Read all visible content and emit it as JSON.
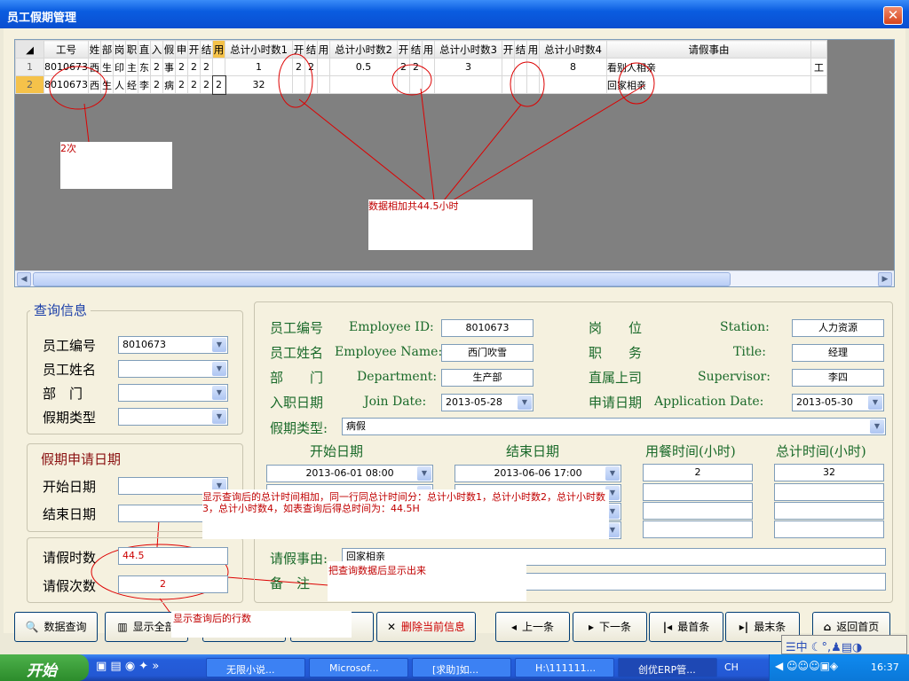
{
  "window": {
    "title": "员工假期管理"
  },
  "grid": {
    "headers": [
      "工号",
      "姓",
      "部",
      "岗",
      "职",
      "直",
      "入",
      "假",
      "申",
      "开",
      "结",
      "用",
      "总计小时数1",
      "开",
      "结",
      "用",
      "总计小时数2",
      "开",
      "结",
      "用",
      "总计小时数3",
      "开",
      "结",
      "用",
      "总计小时数4",
      "请假事由"
    ],
    "rows": [
      {
        "num": "1",
        "cells": [
          "8010673",
          "西",
          "生",
          "印",
          "主",
          "东",
          "2",
          "事",
          "2",
          "2",
          "2",
          "",
          "1",
          "2",
          "2",
          "",
          "0.5",
          "2",
          "2",
          "",
          "3",
          "",
          "",
          "",
          "8",
          "看别人相亲"
        ],
        "extra": "工"
      },
      {
        "num": "2",
        "cells": [
          "8010673",
          "西",
          "生",
          "人",
          "经",
          "李",
          "2",
          "病",
          "2",
          "2",
          "2",
          "2",
          "32",
          "",
          "",
          "",
          "",
          "",
          "",
          "",
          "",
          "",
          "",
          "",
          "",
          "回家相亲"
        ],
        "extra": ""
      }
    ]
  },
  "annotations": {
    "note_count": "2次",
    "note_sum": "数据相加共44.5小时",
    "note_total": "显示查询后的总计时间相加，同一行同总计时间分：总计小时数1，总计小时数2，总计小时数3，总计小时数4，如表查询后得总时间为：44.5H",
    "note_show": "把查询数据后显示出来",
    "note_rows": "显示查询后的行数"
  },
  "query": {
    "title": "查询信息",
    "emp_id_label": "员工编号",
    "emp_id_value": "8010673",
    "emp_name_label": "员工姓名",
    "dept_label": "部　门",
    "leave_type_label": "假期类型",
    "apply_date_title": "假期申请日期",
    "start_label": "开始日期",
    "end_label": "结束日期",
    "hours_label": "请假时数",
    "hours_value": "44.5",
    "times_label": "请假次数",
    "times_value": "2"
  },
  "detail": {
    "emp_id_cn": "员工编号",
    "emp_id_en": "Employee ID:",
    "emp_id": "8010673",
    "emp_name_cn": "员工姓名",
    "emp_name_en": "Employee Name:",
    "emp_name": "西门吹雪",
    "dept_cn": "部　　门",
    "dept_en": "Department:",
    "dept": "生产部",
    "join_cn": "入职日期",
    "join_en": "Join Date:",
    "join": "2013-05-28",
    "station_cn": "岗　　位",
    "station_en": "Station:",
    "station": "人力资源",
    "title_cn": "职　　务",
    "title_en": "Title:",
    "title": "经理",
    "sup_cn": "直属上司",
    "sup_en": "Supervisor:",
    "sup": "李四",
    "app_cn": "申请日期",
    "app_en": "Application Date:",
    "app": "2013-05-30",
    "type_label": "假期类型:",
    "type": "病假",
    "col_start": "开始日期",
    "col_end": "结束日期",
    "col_meal": "用餐时间(小时)",
    "col_total": "总计时间(小时)",
    "start1": "2013-06-01 08:00",
    "end1": "2013-06-06 17:00",
    "meal1": "2",
    "total1": "32",
    "reason_label": "请假事由:",
    "reason": "回家相亲",
    "remark_label": "备　注"
  },
  "buttons": {
    "query": "数据查询",
    "show_all": "显示全部",
    "delete": "删除当前信息",
    "prev": "上一条",
    "next": "下一条",
    "first": "最首条",
    "last": "最末条",
    "home": "返回首页"
  },
  "taskbar": {
    "start": "开始",
    "tasks": [
      "无限小说...",
      "Microsof...",
      "[求助]如...",
      "H:\\111111...",
      "创优ERP管..."
    ],
    "lang": "CH",
    "time": "16:37",
    "ime": "中"
  }
}
